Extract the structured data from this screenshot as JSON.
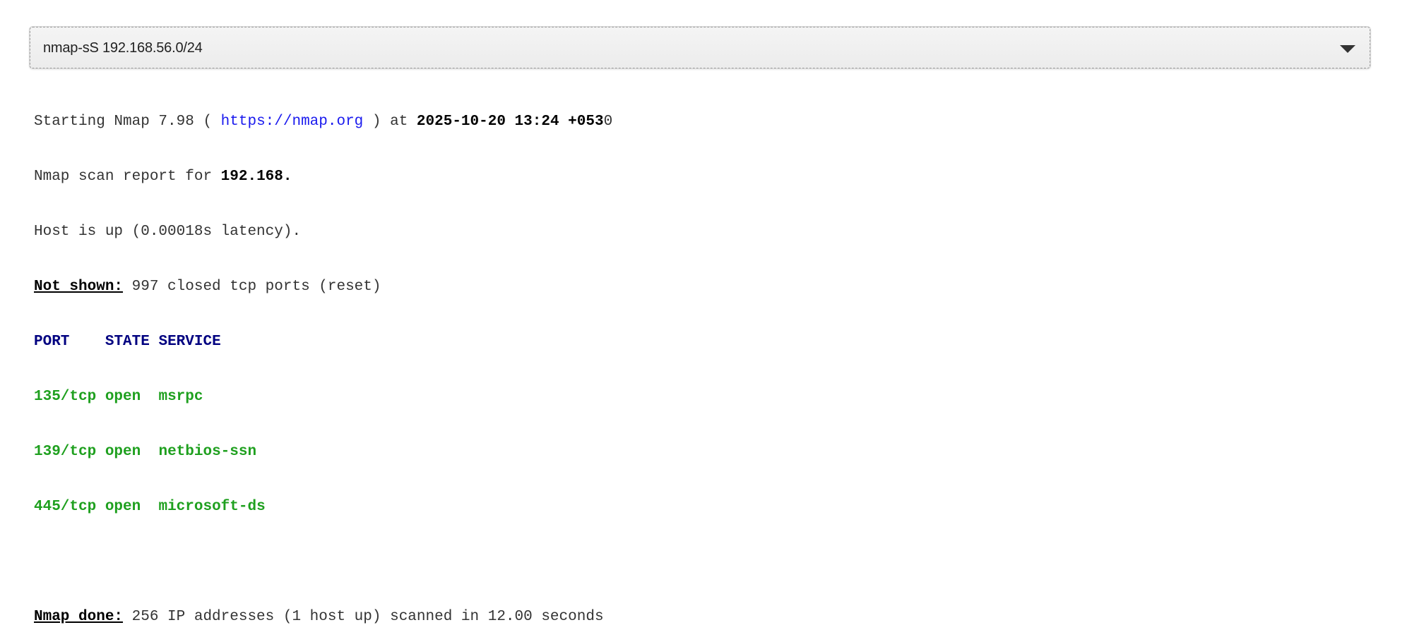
{
  "command": {
    "text": "nmap-sS 192.168.56.0/24",
    "icon": "chevron-down-icon"
  },
  "output": {
    "start_prefix": "Starting Nmap 7.98 ( ",
    "start_url": "https://nmap.org",
    "start_mid": " ) at ",
    "start_datetime": "2025-10-20 13:24 +053",
    "start_tail": "0",
    "report_prefix": "Nmap scan report for ",
    "report_host": "192.168.",
    "host_status": "Host is up (0.00018s latency).",
    "not_shown_label": "Not shown:",
    "not_shown_text": " 997 closed tcp ports (reset)",
    "table_headers": [
      "PORT",
      "STATE",
      "SERVICE"
    ],
    "ports": [
      {
        "port": "135/tcp",
        "state": "open",
        "service": "msrpc"
      },
      {
        "port": "139/tcp",
        "state": "open",
        "service": "netbios-ssn"
      },
      {
        "port": "445/tcp",
        "state": "open",
        "service": "microsoft-ds"
      }
    ],
    "done_label": "Nmap done:",
    "done_text": " 256 IP addresses (1 host up) scanned in 12.00 seconds"
  },
  "colors": {
    "link": "#1a1aee",
    "header": "#000080",
    "open_port": "#1fa01f",
    "text": "#333333"
  }
}
